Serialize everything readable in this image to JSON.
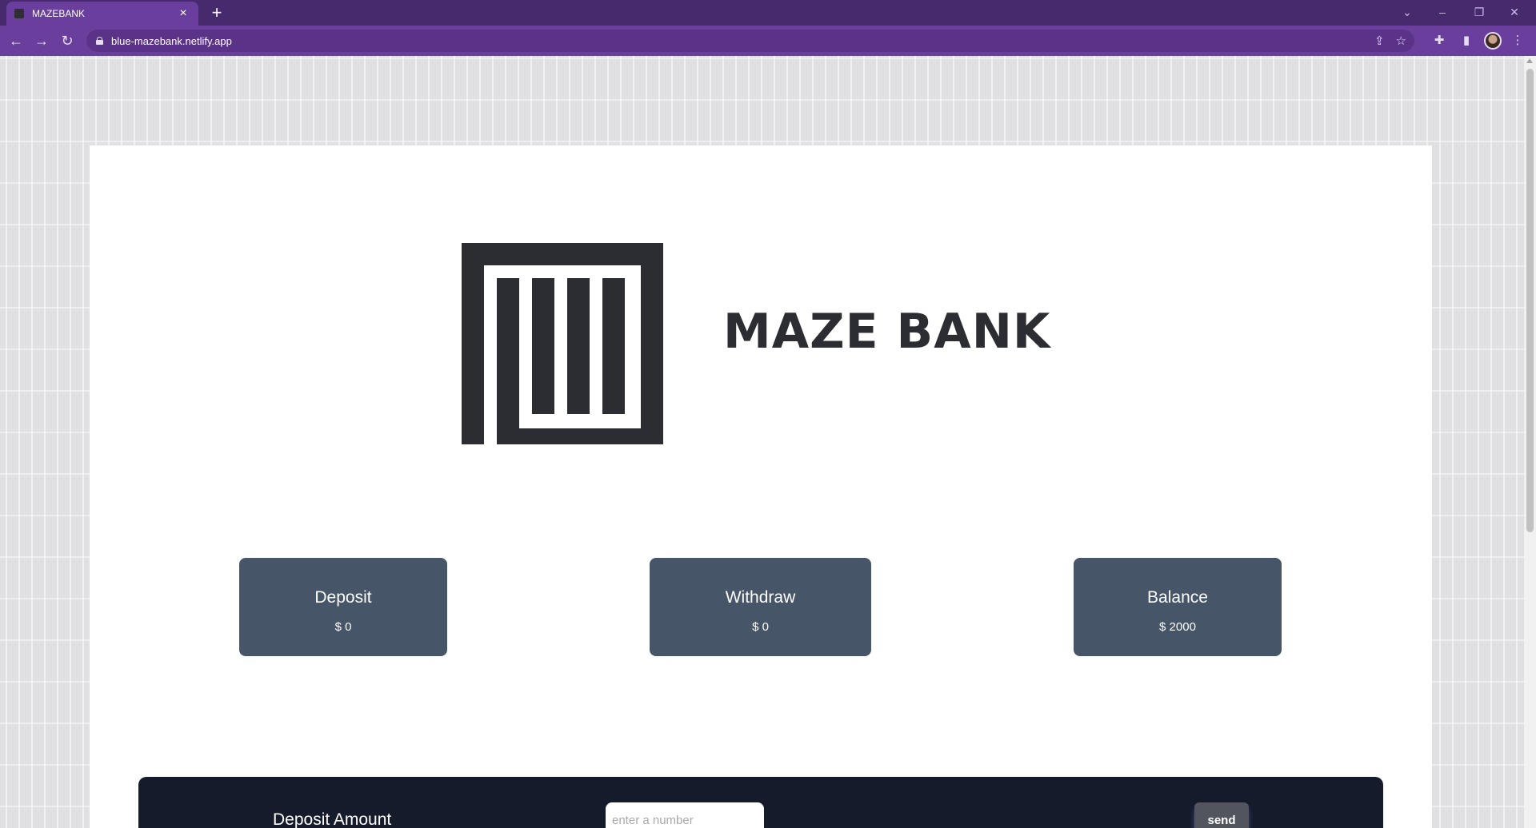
{
  "browser": {
    "tab_title": "MAZEBANK",
    "tab_close_glyph": "×",
    "new_tab_glyph": "+",
    "url": "blue-mazebank.netlify.app",
    "theme_colors": {
      "tabbar": "#472a6e",
      "toolbar": "#6a3e9c"
    },
    "icons": [
      "back-icon",
      "forward-icon",
      "reload-icon",
      "lock-icon",
      "share-icon",
      "bookmark-star-icon",
      "extensions-icon",
      "side-panel-icon",
      "profile-avatar",
      "menu-icon"
    ]
  },
  "bank": {
    "name": "MAZE BANK",
    "logo_icon": "maze-bank-logo",
    "brand_color": "#2c2d32"
  },
  "stats": [
    {
      "label": "Deposit",
      "value": "$ 0"
    },
    {
      "label": "Withdraw",
      "value": "$ 0"
    },
    {
      "label": "Balance",
      "value": "$ 2000"
    }
  ],
  "stat_card_color": "#475569",
  "deposit_form": {
    "label": "Deposit Amount",
    "placeholder": "enter a number",
    "button_label": "send",
    "background_color": "#151b2b"
  }
}
